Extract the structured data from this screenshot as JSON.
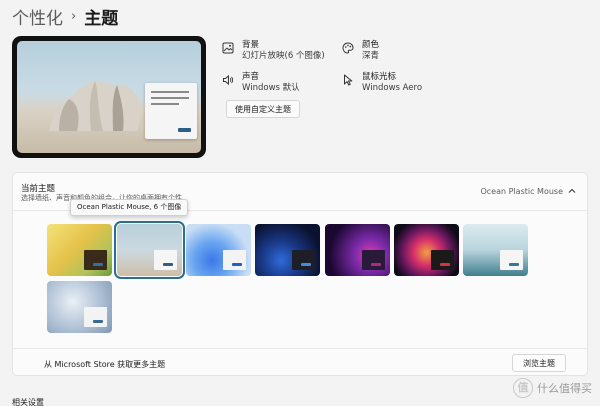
{
  "breadcrumb": {
    "parent": "个性化",
    "separator": "›",
    "current": "主题"
  },
  "props": [
    {
      "title": "背景",
      "value": "幻灯片放映(6 个图像)",
      "icon": "image-icon"
    },
    {
      "title": "颜色",
      "value": "深青",
      "icon": "palette-icon"
    },
    {
      "title": "声音",
      "value": "Windows 默认",
      "icon": "speaker-icon"
    },
    {
      "title": "鼠标光标",
      "value": "Windows Aero",
      "icon": "cursor-icon"
    }
  ],
  "custom_button": "使用自定义主题",
  "current_theme": {
    "title": "当前主题",
    "description": "选择墙纸、声音和颜色的组合，让你的桌面拥有个性",
    "value": "Ocean Plastic Mouse",
    "tooltip": "Ocean Plastic Mouse, 6 个图像"
  },
  "store": {
    "text": "从 Microsoft Store 获取更多主题",
    "browse": "浏览主题"
  },
  "related_settings": "相关设置",
  "watermark": {
    "logo": "值",
    "text": "什么值得买"
  },
  "colors": {
    "accent": "#2b6e8e",
    "panel": "#fbfbfb",
    "background": "#f3f3f3"
  },
  "themes": [
    {
      "name": "theme-yellow-red",
      "bg": "linear-gradient(135deg,#f5e27a 0%,#e5c24a 45%,#b0c35a 75%,#6f9a3a 100%)",
      "win": "#3a2a1a",
      "btn": "#2f6fa8"
    },
    {
      "name": "theme-ocean-plastic-mouse",
      "bg": "linear-gradient(180deg,#b8cfda 0%,#cbd9e0 50%,#cdbfa9 100%)",
      "win": "#f5f5f5",
      "btn": "#2b5f86"
    },
    {
      "name": "theme-windows-light",
      "bg": "radial-gradient(circle at 40% 70%,#3b78e7 0%,#6aa6f0 35%,#c9def5 70%)",
      "win": "#f3f3f3",
      "btn": "#1f5fc8"
    },
    {
      "name": "theme-windows-dark",
      "bg": "radial-gradient(circle at 40% 70%,#2e6bd8 0%,#1a3a8a 35%,#0a1230 75%)",
      "win": "#1e1e28",
      "btn": "#3b8ce3"
    },
    {
      "name": "theme-glow",
      "bg": "radial-gradient(circle at 70% 60%,#e23bb0 0%,#7a2aa8 30%,#1a0830 75%)",
      "win": "#2a1a3a",
      "btn": "#b02a7a"
    },
    {
      "name": "theme-captured-motion",
      "bg": "radial-gradient(circle at 50% 55%,#f0a040 0%,#d8306a 30%,#6a1860 55%,#0e0a18 80%)",
      "win": "#1a1a1a",
      "btn": "#d83040"
    },
    {
      "name": "theme-sunrise-lake",
      "bg": "linear-gradient(180deg,#dcebf0 0%,#b8d4dc 50%,#3f7f8e 100%)",
      "win": "#f5f5f5",
      "btn": "#2f7a94"
    },
    {
      "name": "theme-flow",
      "bg": "radial-gradient(circle at 40% 40%,#eaf0f6 0%,#b9c9db 45%,#7f98b5 100%)",
      "win": "#f3f3f3",
      "btn": "#3a6a90"
    }
  ]
}
